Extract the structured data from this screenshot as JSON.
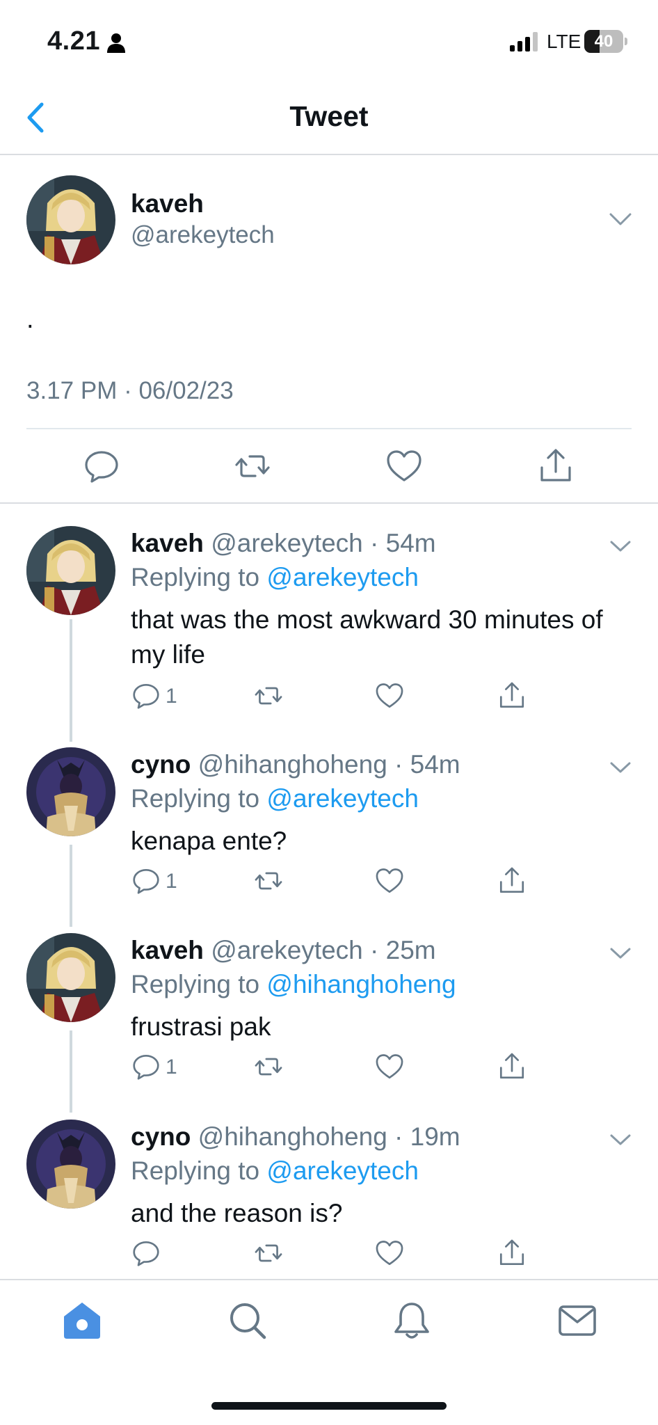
{
  "status_bar": {
    "time": "4.21",
    "network": "LTE",
    "battery_percent": "40",
    "battery_level": 0.4,
    "icons": [
      "person-icon",
      "signal-icon",
      "battery-icon"
    ]
  },
  "header": {
    "title": "Tweet",
    "back_icon": "chevron-left-icon"
  },
  "main_tweet": {
    "name": "kaveh",
    "handle": "@arekeytech",
    "text": ".",
    "timestamp": "3.17 PM · 06/02/23",
    "actions": [
      "reply-icon",
      "retweet-icon",
      "like-icon",
      "share-icon"
    ]
  },
  "replies": [
    {
      "name": "kaveh",
      "meta": "@arekeytech · 54m",
      "replying_prefix": "Replying to ",
      "replying_to": "@arekeytech",
      "text": "that was the most awkward 30 minutes of my life",
      "reply_count": "1"
    },
    {
      "name": "cyno",
      "meta": "@hihanghoheng · 54m",
      "replying_prefix": "Replying to ",
      "replying_to": "@arekeytech",
      "text": "kenapa ente?",
      "reply_count": "1"
    },
    {
      "name": "kaveh",
      "meta": "@arekeytech · 25m",
      "replying_prefix": "Replying to ",
      "replying_to": "@hihanghoheng",
      "text": "frustrasi pak",
      "reply_count": "1"
    },
    {
      "name": "cyno",
      "meta": "@hihanghoheng · 19m",
      "replying_prefix": "Replying to ",
      "replying_to": "@arekeytech",
      "text": "and the reason is?",
      "reply_count": ""
    }
  ],
  "tab_bar": {
    "tabs": [
      "home-icon",
      "search-icon",
      "notifications-icon",
      "messages-icon"
    ],
    "active": "home-icon"
  },
  "colors": {
    "accent": "#1d9bf0",
    "secondary_text": "#657786",
    "divider": "#dadde1",
    "home_tab": "#4a90e2"
  }
}
